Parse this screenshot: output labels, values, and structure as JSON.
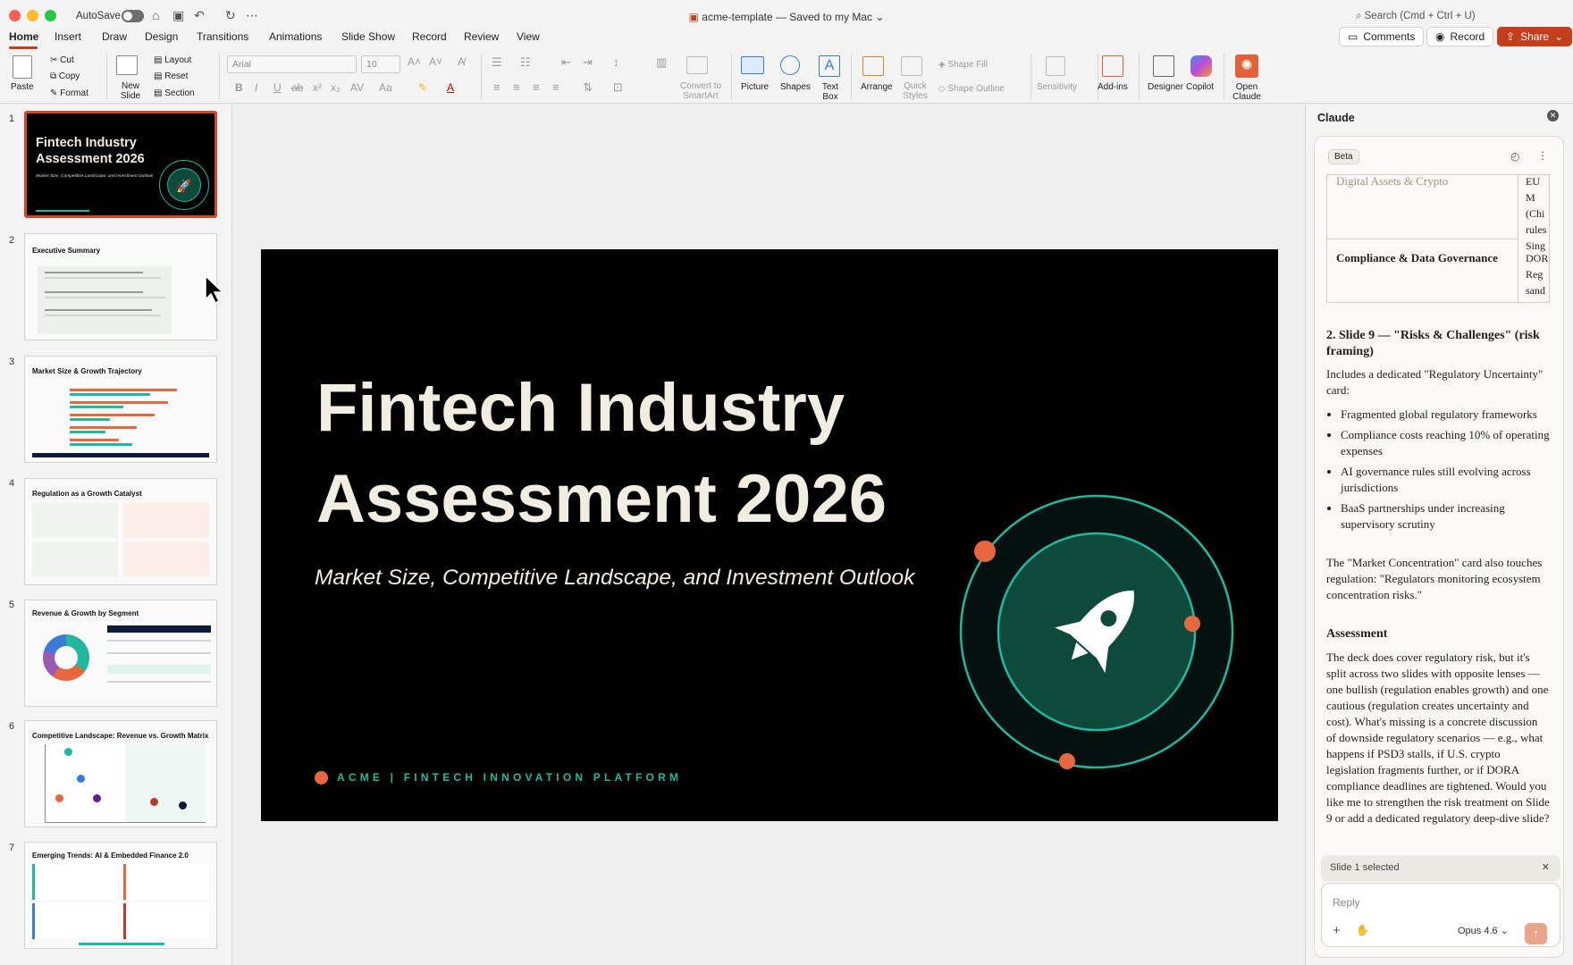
{
  "window": {
    "autosave_label": "AutoSave",
    "doc_title": "acme-template — Saved to my Mac",
    "search_text": "Search (Cmd + Ctrl + U)"
  },
  "tabs": [
    "Home",
    "Insert",
    "Draw",
    "Design",
    "Transitions",
    "Animations",
    "Slide Show",
    "Record",
    "Review",
    "View"
  ],
  "header_buttons": {
    "comments": "Comments",
    "record": "Record",
    "share": "Share"
  },
  "ribbon": {
    "paste": "Paste",
    "cut": "Cut",
    "copy": "Copy",
    "format": "Format",
    "new_slide": "New Slide",
    "layout": "Layout",
    "reset": "Reset",
    "section": "Section",
    "font_name": "Arial",
    "font_size": "10",
    "convert_smartart": "Convert to SmartArt",
    "picture": "Picture",
    "shapes": "Shapes",
    "text_box": "Text Box",
    "arrange": "Arrange",
    "quick_styles": "Quick Styles",
    "shape_fill": "Shape Fill",
    "shape_outline": "Shape Outline",
    "sensitivity": "Sensitivity",
    "addins": "Add-ins",
    "designer": "Designer",
    "copilot": "Copilot",
    "open_claude": "Open Claude"
  },
  "thumbnails": [
    {
      "num": "1",
      "title": "Fintech Industry Assessment 2026",
      "subtitle": "Market Size, Competitive Landscape, and Investment Outlook"
    },
    {
      "num": "2",
      "title": "Executive Summary"
    },
    {
      "num": "3",
      "title": "Market Size & Growth Trajectory"
    },
    {
      "num": "4",
      "title": "Regulation as a Growth Catalyst"
    },
    {
      "num": "5",
      "title": "Revenue & Growth by Segment"
    },
    {
      "num": "6",
      "title": "Competitive Landscape: Revenue vs. Growth Matrix"
    },
    {
      "num": "7",
      "title": "Emerging Trends: AI & Embedded Finance 2.0"
    }
  ],
  "slide": {
    "title_line1": "Fintech Industry",
    "title_line2": "Assessment 2026",
    "subtitle": "Market Size, Competitive Landscape, and Investment Outlook",
    "footer": "ACME | FINTECH INNOVATION PLATFORM",
    "colors": {
      "background": "#000000",
      "title": "#f2ede2",
      "accent_teal": "#20b9a0",
      "accent_orange": "#e8673f"
    }
  },
  "claude": {
    "header": "Claude",
    "beta": "Beta",
    "table_row1_label": "Digital Assets & Crypto",
    "table_row1_value": "EU M (Chi rules Sing",
    "table_row2_label": "Compliance & Data Governance",
    "table_row2_value": "DOR Reg sand",
    "heading1": "2. Slide 9 — \"Risks & Challenges\" (risk framing)",
    "intro": "Includes a dedicated \"Regulatory Uncertainty\" card:",
    "bullets": [
      "Fragmented global regulatory frameworks",
      "Compliance costs reaching 10% of operating expenses",
      "AI governance rules still evolving across jurisdictions",
      "BaaS partnerships under increasing supervisory scrutiny"
    ],
    "market_note": "The \"Market Concentration\" card also touches regulation: \"Regulators monitoring ecosystem concentration risks.\"",
    "assessment_heading": "Assessment",
    "assessment_text": "The deck does cover regulatory risk, but it's split across two slides with opposite lenses — one bullish (regulation enables growth) and one cautious (regulation creates uncertainty and cost). What's missing is a concrete discussion of downside regulatory scenarios — e.g., what happens if PSD3 stalls, if U.S. crypto legislation fragments further, or if DORA compliance deadlines are tightened. Would you like me to strengthen the risk treatment on Slide 9 or add a dedicated regulatory deep-dive slide?",
    "selected": "Slide 1 selected",
    "reply_placeholder": "Reply",
    "model": "Opus 4.6"
  }
}
